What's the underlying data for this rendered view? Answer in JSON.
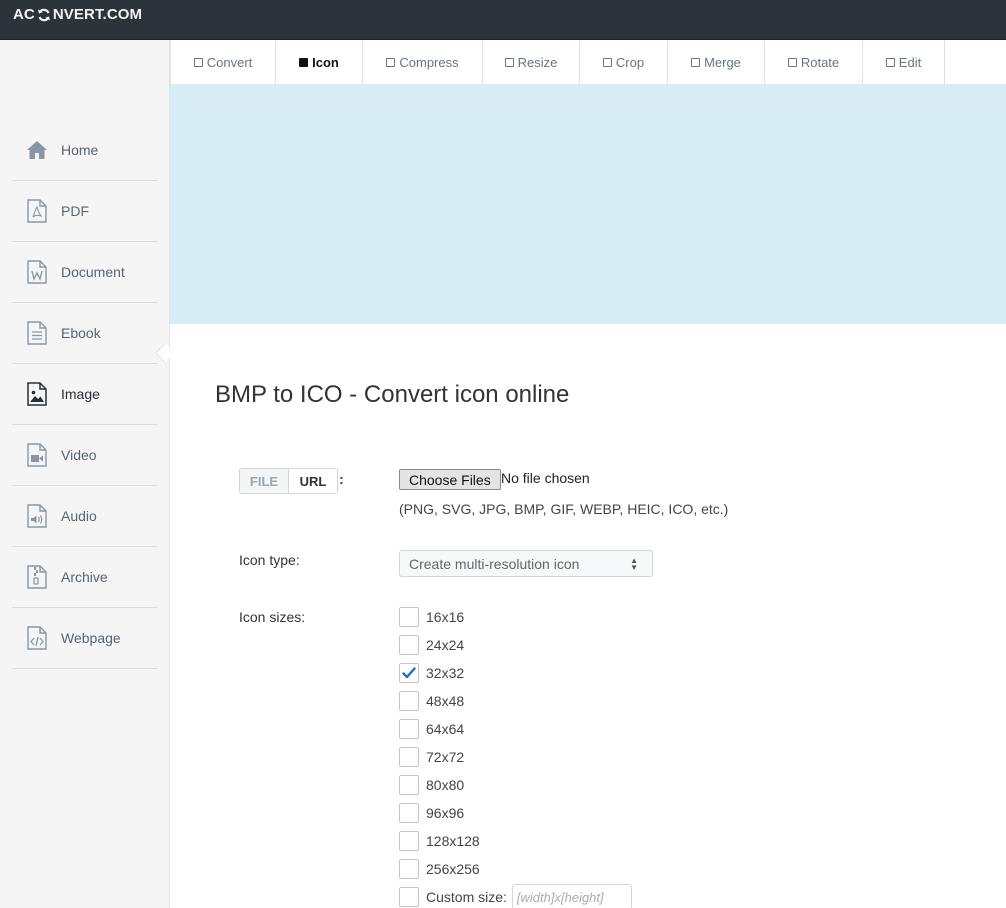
{
  "brand": {
    "logo_left": "AC",
    "logo_right": "NVERT.COM",
    "logo_icon": "refresh-icon"
  },
  "sidebar": {
    "items": [
      {
        "label": "Home",
        "icon": "home-icon"
      },
      {
        "label": "PDF",
        "icon": "pdf-file-icon"
      },
      {
        "label": "Document",
        "icon": "word-file-icon"
      },
      {
        "label": "Ebook",
        "icon": "ebook-file-icon"
      },
      {
        "label": "Image",
        "icon": "image-file-icon",
        "active": true
      },
      {
        "label": "Video",
        "icon": "video-file-icon"
      },
      {
        "label": "Audio",
        "icon": "audio-file-icon"
      },
      {
        "label": "Archive",
        "icon": "archive-file-icon"
      },
      {
        "label": "Webpage",
        "icon": "code-file-icon"
      }
    ]
  },
  "tabs": [
    {
      "label": "Convert"
    },
    {
      "label": "Icon",
      "active": true
    },
    {
      "label": "Compress"
    },
    {
      "label": "Resize"
    },
    {
      "label": "Crop"
    },
    {
      "label": "Merge"
    },
    {
      "label": "Rotate"
    },
    {
      "label": "Edit"
    }
  ],
  "main": {
    "title": "BMP to ICO - Convert icon online",
    "source_toggle": {
      "file": "FILE",
      "url": "URL",
      "colon": ":"
    },
    "file_input": {
      "button": "Choose Files",
      "status": "No file chosen"
    },
    "formats_hint": "(PNG, SVG, JPG, BMP, GIF, WEBP, HEIC, ICO, etc.)",
    "icon_type": {
      "label": "Icon type:",
      "selected": "Create multi-resolution icon"
    },
    "icon_sizes": {
      "label": "Icon sizes:",
      "options": [
        {
          "label": "16x16",
          "checked": false
        },
        {
          "label": "24x24",
          "checked": false
        },
        {
          "label": "32x32",
          "checked": true
        },
        {
          "label": "48x48",
          "checked": false
        },
        {
          "label": "64x64",
          "checked": false
        },
        {
          "label": "72x72",
          "checked": false
        },
        {
          "label": "80x80",
          "checked": false
        },
        {
          "label": "96x96",
          "checked": false
        },
        {
          "label": "128x128",
          "checked": false
        },
        {
          "label": "256x256",
          "checked": false
        }
      ],
      "custom": {
        "label": "Custom size:",
        "placeholder": "[width]x[height]",
        "checked": false
      }
    }
  },
  "colors": {
    "topbar": "#2d333b",
    "banner": "#d9edf6",
    "sidebar": "#f5f5f5",
    "check": "#1a6fd1"
  }
}
